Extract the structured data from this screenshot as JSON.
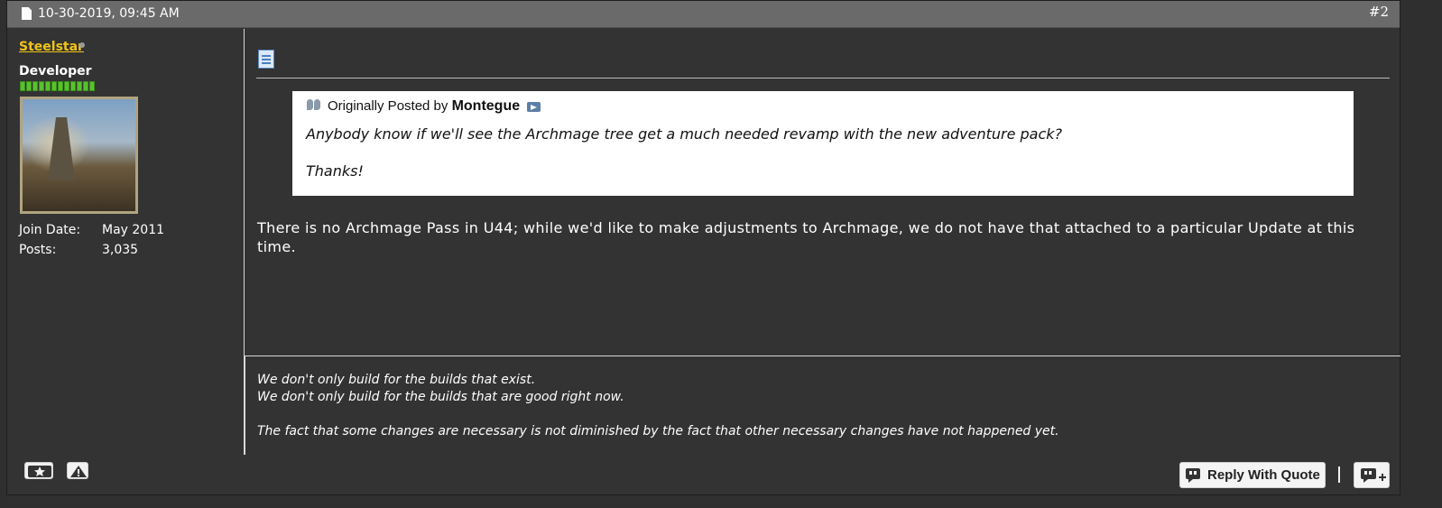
{
  "post": {
    "date": "10-30-2019, 09:45 AM",
    "number": "#2"
  },
  "user": {
    "name": "Steelstar",
    "title": "Developer",
    "reputation_pips": 12,
    "join_label": "Join Date:",
    "join_value": "May 2011",
    "posts_label": "Posts:",
    "posts_value": "3,035"
  },
  "quote": {
    "prefix": "Originally Posted by",
    "author": "Montegue",
    "line1": "Anybody know if we'll see the Archmage tree get a much needed revamp with the new adventure pack?",
    "line2": "Thanks!"
  },
  "message": "There is no Archmage Pass in U44; while we'd like to make adjustments to Archmage, we do not have that attached to a particular Update at this time.",
  "signature": {
    "line1": "We don't only build for the builds that exist.",
    "line2": "We don't only build for the builds that are good right now.",
    "line3": "The fact that some changes are necessary is not diminished by the fact that other necessary changes have not happened yet."
  },
  "footer": {
    "reply_with_quote": "Reply With Quote"
  },
  "icons": {
    "post_header": "document-icon",
    "post_icon": "document-lines-icon",
    "quote": "quote-marks-icon",
    "view_post": "view-post-arrow-icon",
    "reputation": "star-reputation-icon",
    "report": "warning-triangle-icon",
    "reply_quote": "speech-bubble-quote-icon",
    "multiquote": "speech-bubble-plus-icon"
  },
  "colors": {
    "username": "#f0c419",
    "header_bar": "#6a6a6a",
    "post_bg": "#333333",
    "reputation_green": "#58c22d"
  }
}
